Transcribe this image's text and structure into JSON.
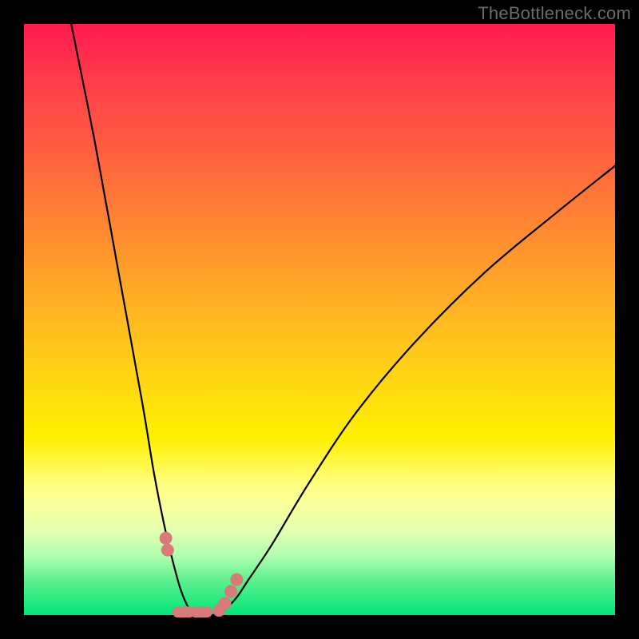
{
  "watermark": "TheBottleneck.com",
  "chart_data": {
    "type": "line",
    "title": "",
    "xlabel": "",
    "ylabel": "",
    "xlim": [
      0,
      100
    ],
    "ylim": [
      0,
      100
    ],
    "grid": false,
    "series": [
      {
        "name": "curve",
        "x": [
          8,
          12,
          16,
          20,
          22,
          24,
          26,
          27,
          28,
          29,
          30,
          32,
          34,
          36,
          38,
          42,
          48,
          56,
          66,
          78,
          90,
          100
        ],
        "y": [
          100,
          80,
          58,
          36,
          24,
          14,
          6,
          3,
          1,
          0,
          0,
          0,
          1,
          3,
          6,
          12,
          22,
          34,
          46,
          58,
          68,
          76
        ]
      }
    ],
    "markers": [
      {
        "x": 24.0,
        "y": 13.0,
        "shape": "round"
      },
      {
        "x": 24.3,
        "y": 11.0,
        "shape": "round"
      },
      {
        "x": 27.0,
        "y": 0.5,
        "shape": "wide"
      },
      {
        "x": 30.0,
        "y": 0.5,
        "shape": "wide"
      },
      {
        "x": 33.0,
        "y": 0.8,
        "shape": "round"
      },
      {
        "x": 34.0,
        "y": 2.0,
        "shape": "round"
      },
      {
        "x": 35.0,
        "y": 4.0,
        "shape": "round"
      },
      {
        "x": 36.0,
        "y": 6.0,
        "shape": "round"
      }
    ],
    "background_gradient": {
      "top": "#ff1a50",
      "mid": "#fff000",
      "bottom": "#00e676"
    }
  }
}
